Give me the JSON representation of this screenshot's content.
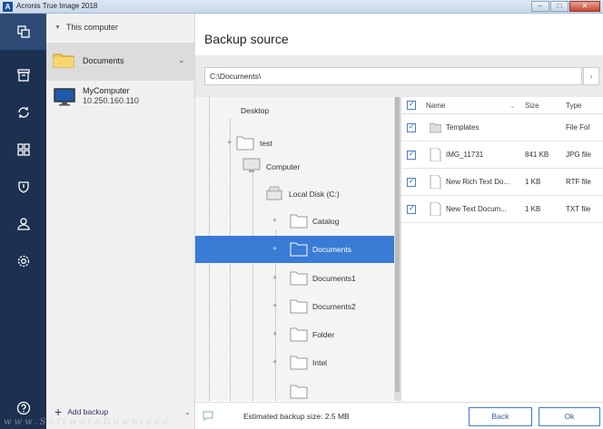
{
  "window": {
    "title": "Acronis True Image 2018",
    "app_icon_letter": "A",
    "buttons": {
      "minimize": "–",
      "maximize": "□",
      "close": "✕"
    }
  },
  "rail": {
    "icons": [
      "copy-icon",
      "archive-icon",
      "sync-icon",
      "dashboard-icon",
      "shield-icon",
      "account-icon",
      "settings-icon",
      "help-icon"
    ],
    "active_index": 0
  },
  "sources": {
    "this_computer": "This computer",
    "selected_source": "Documents",
    "computer_name": "MyComputer",
    "computer_ip": "10.250.160.110",
    "add_backup": "Add backup"
  },
  "main": {
    "title": "Backup source",
    "path": "C:\\Documents\\",
    "path_go": "›"
  },
  "tree": {
    "items": [
      {
        "label": "Desktop"
      },
      {
        "label": "test"
      },
      {
        "label": "Computer"
      },
      {
        "label": "Local Disk (C:)"
      },
      {
        "label": "Catalog"
      },
      {
        "label": "Documents"
      },
      {
        "label": "Documents1"
      },
      {
        "label": "Documents2"
      },
      {
        "label": "Folder"
      },
      {
        "label": "Intel"
      }
    ],
    "selected": "Documents"
  },
  "files": {
    "columns": {
      "name": "Name",
      "size": "Size",
      "type": "Type"
    },
    "rows": [
      {
        "name": "Templates",
        "size": "",
        "type": "File Fol",
        "checked": true
      },
      {
        "name": "IMG_11731",
        "size": "841 KB",
        "type": "JPG file",
        "checked": true
      },
      {
        "name": "New Rich Text Do...",
        "size": "1 KB",
        "type": "RTF file",
        "checked": true
      },
      {
        "name": "New Text Docum...",
        "size": "1 KB",
        "type": "TXT file",
        "checked": true
      }
    ]
  },
  "footer": {
    "estimated": "Estimated backup size: 2.5 MB",
    "back": "Back",
    "ok": "Ok"
  },
  "watermark": "www.SoftwareDownload",
  "colors": {
    "rail_bg": "#1c3151",
    "rail_active": "#2d4a74",
    "selection": "#3a7bd5",
    "accent": "#2a5fa8"
  }
}
